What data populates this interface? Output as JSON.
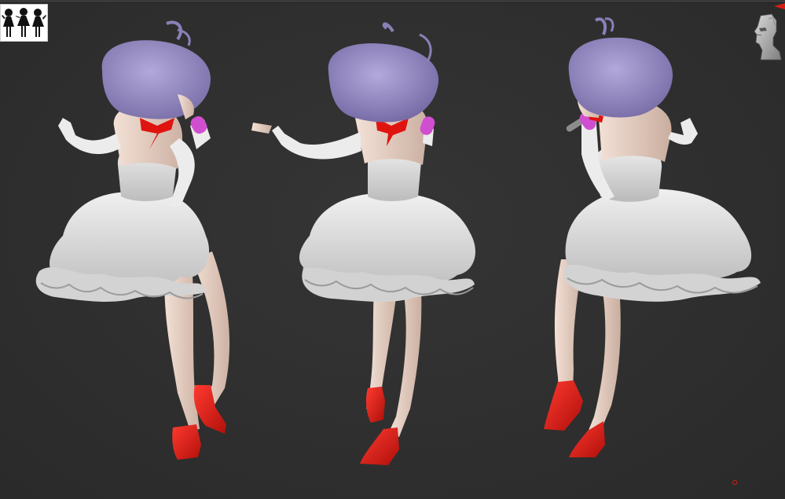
{
  "scene": {
    "background_color": "#2f2f2f",
    "views": [
      "left-three-quarter-view",
      "back-view",
      "right-three-quarter-view"
    ]
  },
  "thumbnail": {
    "icon": "figure-silhouettes-icon",
    "count": 3
  },
  "navigation": {
    "icon": "head-gizmo-icon"
  },
  "colors": {
    "hair": "#9e93c8",
    "skin": "#e9d3c7",
    "dress": "#dedede",
    "accent_red": "#e0140f",
    "popsicle": "#d04fd0"
  }
}
